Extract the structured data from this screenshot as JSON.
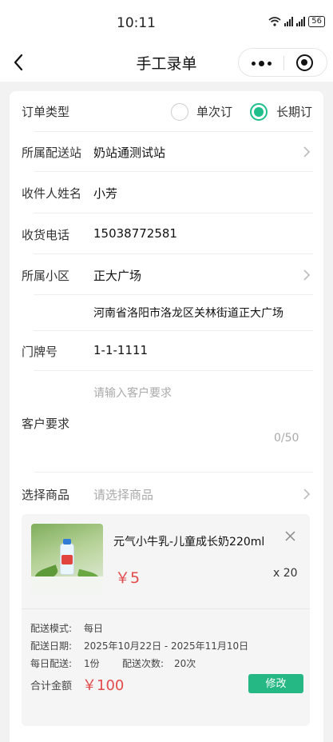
{
  "status_bar": {
    "time": "10:11",
    "battery": "56"
  },
  "nav": {
    "title": "手工录单"
  },
  "form": {
    "order_type": {
      "label": "订单类型",
      "options": [
        "单次订",
        "长期订"
      ],
      "selected": "长期订"
    },
    "station": {
      "label": "所属配送站",
      "value": "奶站通测试站"
    },
    "recipient": {
      "label": "收件人姓名",
      "value": "小芳"
    },
    "phone": {
      "label": "收货电话",
      "value": "15038772581"
    },
    "community": {
      "label": "所属小区",
      "value": "正大广场",
      "address": "河南省洛阳市洛龙区关林街道正大广场"
    },
    "door": {
      "label": "门牌号",
      "value": "1-1-1111"
    },
    "requirement": {
      "label": "客户要求",
      "placeholder": "请输入客户要求",
      "counter": "0/50"
    },
    "goods": {
      "label": "选择商品",
      "placeholder": "请选择商品"
    }
  },
  "product": {
    "name": "元气小牛乳-儿童成长奶220ml",
    "price": "￥5",
    "qty": "x 20",
    "mode_label": "配送模式:",
    "mode_value": "每日",
    "date_label": "配送日期:",
    "date_value": "2025年10月22日 - 2025年11月10日",
    "daily_label": "每日配送:",
    "daily_value": "1份",
    "count_label": "配送次数:",
    "count_value": "20次",
    "total_label": "合计金额",
    "total_value": "￥100",
    "edit_label": "修改"
  },
  "colors": {
    "accent": "#1fbe8a",
    "price": "#e24b4b"
  }
}
